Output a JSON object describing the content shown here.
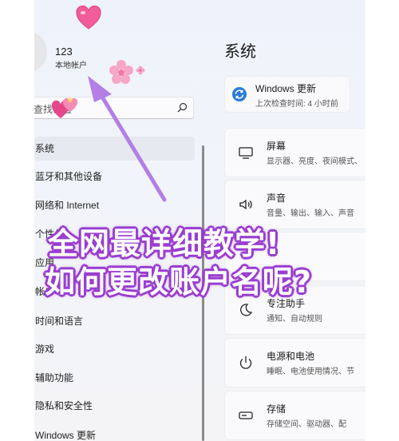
{
  "account": {
    "name": "123",
    "type": "本地帐户"
  },
  "search": {
    "placeholder": "查找设置"
  },
  "sidebar": {
    "items": [
      {
        "label": "系统",
        "active": true
      },
      {
        "label": "蓝牙和其他设备"
      },
      {
        "label": "网络和 Internet"
      },
      {
        "label": "个性化"
      },
      {
        "label": "应用"
      },
      {
        "label": "帐户"
      },
      {
        "label": "时间和语言"
      },
      {
        "label": "游戏"
      },
      {
        "label": "辅助功能"
      },
      {
        "label": "隐私和安全性"
      },
      {
        "label": "Windows 更新"
      }
    ]
  },
  "main": {
    "title": "系统",
    "update": {
      "title": "Windows 更新",
      "subtitle": "上次检查时间: 4 小时前"
    },
    "cards": [
      {
        "icon": "monitor-icon",
        "title": "屏幕",
        "subtitle": "显示器、亮度、夜间模式、"
      },
      {
        "icon": "speaker-icon",
        "title": "声音",
        "subtitle": "音量、输出、输入、声音"
      },
      {
        "icon": "moon-icon",
        "title": "专注助手",
        "subtitle": "通知、自动规则"
      },
      {
        "icon": "power-icon",
        "title": "电源和电池",
        "subtitle": "睡眠、电池使用情况、节"
      },
      {
        "icon": "storage-icon",
        "title": "存储",
        "subtitle": "存储空间、驱动器、配"
      }
    ]
  },
  "overlay": {
    "line1": "全网最详细教学!",
    "line2": "如何更改账户名呢?"
  },
  "colors": {
    "accent": "#9a3fd0",
    "arrow": "#b37ee6"
  }
}
